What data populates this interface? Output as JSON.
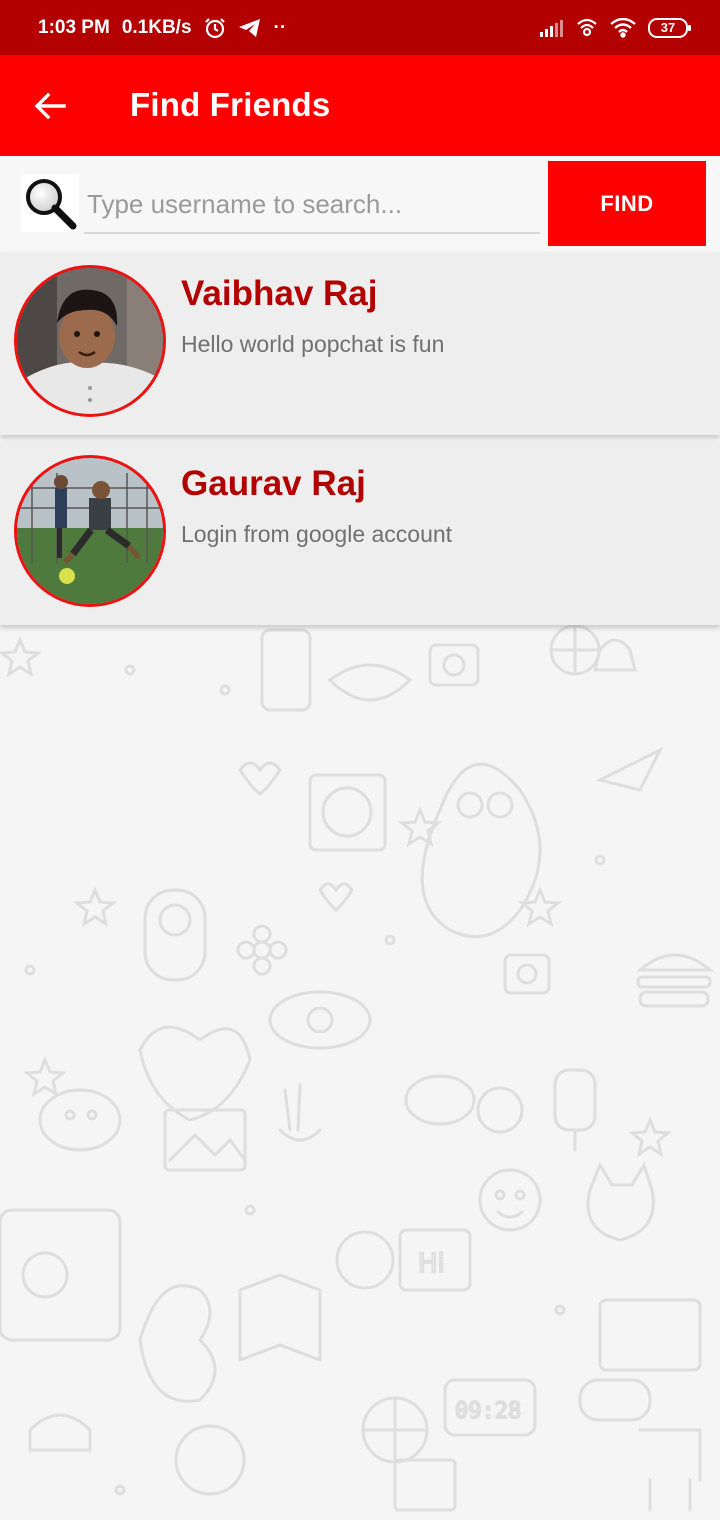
{
  "status_bar": {
    "time": "1:03 PM",
    "net_speed": "0.1KB/s",
    "dots": "··",
    "battery": "37",
    "icons": [
      "alarm-icon",
      "telegram-icon",
      "signal-icon",
      "hotspot-icon",
      "wifi-icon",
      "battery-icon"
    ]
  },
  "app_bar": {
    "back_icon": "arrow-left-icon",
    "title": "Find Friends",
    "color": "#ff0000"
  },
  "search": {
    "icon": "magnifier-icon",
    "placeholder": "Type username to search...",
    "value": "",
    "button_label": "FIND"
  },
  "friends": [
    {
      "name": "Vaibhav Raj",
      "status": "Hello world popchat is fun"
    },
    {
      "name": "Gaurav Raj",
      "status": "Login from google account"
    }
  ],
  "colors": {
    "status_bar": "#b30000",
    "accent": "#ff0000",
    "name_text": "#b30000",
    "card_bg": "#eeeeee"
  }
}
